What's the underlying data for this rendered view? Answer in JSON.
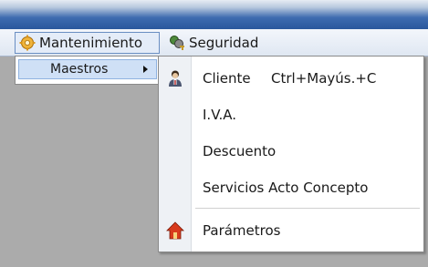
{
  "menubar": {
    "items": [
      {
        "label": "Mantenimiento",
        "icon": "gear-icon"
      },
      {
        "label": "Seguridad",
        "icon": "keys-icon"
      }
    ]
  },
  "mantenimiento_menu": {
    "items": [
      {
        "label": "Maestros",
        "has_submenu": true
      }
    ]
  },
  "maestros_menu": {
    "items": [
      {
        "label": "Cliente",
        "shortcut": "Ctrl+Mayús.+C",
        "icon": "person-icon"
      },
      {
        "label": "I.V.A."
      },
      {
        "label": "Descuento"
      },
      {
        "label": "Servicios Acto Concepto"
      },
      {
        "label": "Parámetros",
        "icon": "home-icon"
      }
    ]
  },
  "colors": {
    "title_bar": "#2a579c",
    "menubar": "#dfe7f2",
    "highlight": "#cfe0f6",
    "background": "#ababab"
  }
}
